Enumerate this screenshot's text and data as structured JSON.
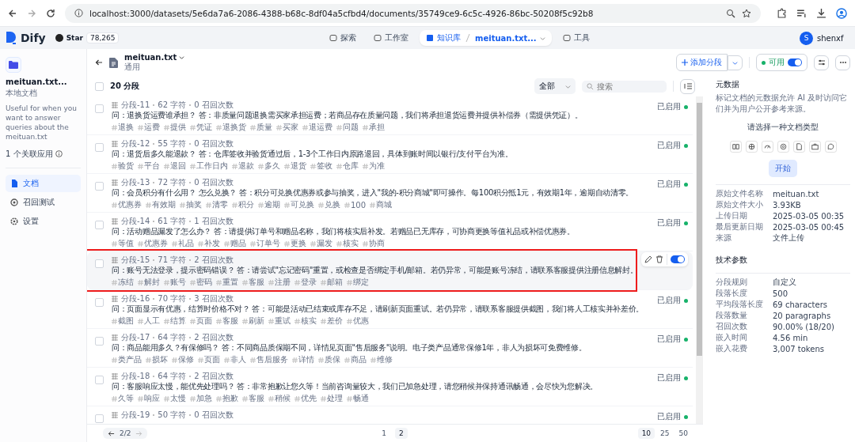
{
  "browser": {
    "url": "localhost:3000/datasets/5e6da7a6-2086-4388-b68c-8df04a5cfbd4/documents/35749ce9-6c5c-4926-86bc-50208f5c92b8"
  },
  "nav": {
    "brand": "Dify",
    "star_label": "Star",
    "star_count": "78,265",
    "tabs": [
      {
        "label": "探索",
        "selected": false,
        "kind": "explore"
      },
      {
        "label": "工作室",
        "selected": false,
        "kind": "studio"
      },
      {
        "label": "知识库",
        "selected": true,
        "kind": "knowledge",
        "crumb": "meituan.txt..."
      },
      {
        "label": "工具",
        "selected": false,
        "kind": "tools"
      }
    ],
    "user": {
      "initial": "S",
      "name": "shenxf"
    }
  },
  "sidebar": {
    "title": "meituan.txt...",
    "subtitle": "本地文档",
    "description": "Useful for when you want to answer queries about the meituan.txt",
    "linked_apps": "1 个关联应用",
    "items": [
      {
        "label": "文档",
        "selected": true,
        "kind": "docs"
      },
      {
        "label": "召回测试",
        "selected": false,
        "kind": "test"
      },
      {
        "label": "设置",
        "selected": false,
        "kind": "settings"
      }
    ]
  },
  "document": {
    "title": "meituan.txt",
    "mode": "通用",
    "add_button": "添加分段",
    "status": "可用",
    "enabled": true
  },
  "list": {
    "count": "20 分段",
    "all_checked": false,
    "filter": "全部",
    "search_placeholder": "搜索",
    "segments": [
      {
        "label": "分段-11",
        "chars": "62 字符",
        "recalls": "0 召回次数",
        "text": "问：退换货运费谁承担？ 答：非质量问题退换需买家承担运费；若商品存在质量问题，我们将承担退货运费并提供补偿券（需提供凭证）。",
        "keywords": [
          "退换",
          "运费",
          "提供",
          "凭证",
          "退换货",
          "质量",
          "买家",
          "退运费",
          "问题",
          "承担"
        ],
        "status": "已启用",
        "enabled": true,
        "checked": false,
        "hovered": false,
        "annotated": false
      },
      {
        "label": "分段-12",
        "chars": "55 字符",
        "recalls": "0 召回次数",
        "text": "问：退货后多久能退款？ 答：仓库签收并验货通过后，1-3个工作日内原路退回，具体到账时间以银行/支付平台为准。",
        "keywords": [
          "验货",
          "平台",
          "退回",
          "工作日内",
          "退款",
          "多久",
          "退货",
          "签收",
          "仓库",
          "为准"
        ],
        "status": "已启用",
        "enabled": true,
        "checked": false,
        "hovered": false,
        "annotated": false
      },
      {
        "label": "分段-13",
        "chars": "72 字符",
        "recalls": "0 召回次数",
        "text": "问：会员积分有什么用？ 怎么兑换？ 答：积分可兑换优惠券或参与抽奖，进入\"我的-积分商城\"即可操作。每100积分抵1元，有效期1年，逾期自动清零。",
        "keywords": [
          "优惠券",
          "有效期",
          "抽奖",
          "清零",
          "积分",
          "逾期",
          "可兑换",
          "兑换",
          "100",
          "商城"
        ],
        "status": "已启用",
        "enabled": true,
        "checked": false,
        "hovered": false,
        "annotated": false
      },
      {
        "label": "分段-14",
        "chars": "61 字符",
        "recalls": "1 召回次数",
        "text": "问：活动赠品漏发了怎么办？ 答：请提供订单号和赠品名称，我们将核实后补发。若赠品已无库存，可协商更换等值礼品或补偿优惠券。",
        "keywords": [
          "等值",
          "优惠券",
          "礼品",
          "补发",
          "赠品",
          "订单号",
          "更换",
          "漏发",
          "核实",
          "协商"
        ],
        "status": "已启用",
        "enabled": true,
        "checked": false,
        "hovered": false,
        "annotated": false
      },
      {
        "label": "分段-15",
        "chars": "71 字符",
        "recalls": "2 召回次数",
        "text": "问：账号无法登录，提示密码错误？ 答：请尝试\"忘记密码\"重置，或检查是否绑定手机/邮箱。若仍异常，可能是账号冻结，请联系客服提供注册信息解封。",
        "keywords": [
          "冻结",
          "解封",
          "账号",
          "密码",
          "重置",
          "客服",
          "注册",
          "登录",
          "邮箱",
          "绑定"
        ],
        "enabled": true,
        "checked": false,
        "hovered": true,
        "annotated": true
      },
      {
        "label": "分段-16",
        "chars": "70 字符",
        "recalls": "3 召回次数",
        "text": "问：页面显示有优惠，结算时价格不对？ 答：可能是活动已结束或库存不足，请刷新页面重试。若仍异常，请联系客服提供截图，我们将人工核实并补差价。",
        "keywords": [
          "截图",
          "人工",
          "结算",
          "页面",
          "客服",
          "刷新",
          "重试",
          "核实",
          "差价",
          "优惠"
        ],
        "status": "已启用",
        "enabled": true,
        "checked": false,
        "hovered": false,
        "annotated": false
      },
      {
        "label": "分段-17",
        "chars": "64 字符",
        "recalls": "2 召回次数",
        "text": "问：商品能用多久？有保修吗？ 答：不同商品质保期不同，详情见页面\"售后服务\"说明。电子类产品通常保修1年，非人为损坏可免费维修。",
        "keywords": [
          "类产品",
          "损坏",
          "保修",
          "页面",
          "非人",
          "售后服务",
          "详情",
          "质保",
          "商品",
          "维修"
        ],
        "status": "已启用",
        "enabled": true,
        "checked": false,
        "hovered": false,
        "annotated": false
      },
      {
        "label": "分段-18",
        "chars": "64 字符",
        "recalls": "2 召回次数",
        "text": "问：客服响应太慢，能优先处理吗？ 答：非常抱歉让您久等！当前咨询量较大，我们已加急处理，请您稍候并保持通讯畅通，会尽快为您解决。",
        "keywords": [
          "久等",
          "响应",
          "太慢",
          "加急",
          "抱歉",
          "客服",
          "稍候",
          "优先",
          "处理",
          "畅通"
        ],
        "status": "已启用",
        "enabled": true,
        "checked": false,
        "hovered": false,
        "annotated": false
      },
      {
        "label": "分段-19",
        "chars": "50 字符",
        "recalls": "0 召回次数",
        "status": "已启用",
        "enabled": true,
        "checked": false,
        "hovered": false,
        "annotated": false
      }
    ]
  },
  "pagination": {
    "page_info": "2/2",
    "pages": [
      {
        "label": "1",
        "selected": false
      },
      {
        "label": "2",
        "selected": true
      }
    ],
    "sizes": [
      {
        "label": "10",
        "selected": true
      },
      {
        "label": "25",
        "selected": false
      },
      {
        "label": "50",
        "selected": false
      }
    ]
  },
  "metadata": {
    "title": "元数据",
    "description": "标记文档的元数据允许 AI 及时访问它们并为用户公开参考来源。",
    "prompt": "请选择一种文档类型",
    "start_button": "开始",
    "start_disabled": true,
    "fields": [
      {
        "label": "原始文件名称",
        "value": "meituan.txt"
      },
      {
        "label": "原始文件大小",
        "value": "3.93KB"
      },
      {
        "label": "上传日期",
        "value": "2025-03-05 00:35"
      },
      {
        "label": "最后更新日期",
        "value": "2025-03-05 00:45"
      },
      {
        "label": "来源",
        "value": "文件上传"
      }
    ]
  },
  "technical": {
    "title": "技术参数",
    "fields": [
      {
        "label": "分段规则",
        "value": "自定义"
      },
      {
        "label": "段落长度",
        "value": "500"
      },
      {
        "label": "平均段落长度",
        "value": "69 characters"
      },
      {
        "label": "段落数量",
        "value": "20 paragraphs"
      },
      {
        "label": "召回次数",
        "value": "90.00% (18/20)"
      },
      {
        "label": "嵌入时间",
        "value": "4.56 min"
      },
      {
        "label": "嵌入花费",
        "value": "3,007 tokens"
      }
    ]
  }
}
